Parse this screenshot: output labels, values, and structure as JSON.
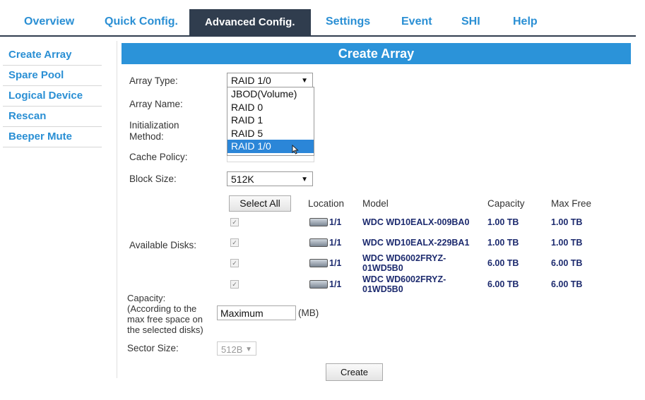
{
  "nav": {
    "tabs": [
      {
        "label": "Overview"
      },
      {
        "label": "Quick Config."
      },
      {
        "label": "Advanced Config."
      },
      {
        "label": "Settings"
      },
      {
        "label": "Event"
      },
      {
        "label": "SHI"
      },
      {
        "label": "Help"
      }
    ],
    "active_tab": "Advanced Config."
  },
  "sidebar": {
    "items": [
      {
        "label": "Create Array"
      },
      {
        "label": "Spare Pool"
      },
      {
        "label": "Logical Device"
      },
      {
        "label": "Rescan"
      },
      {
        "label": "Beeper Mute"
      }
    ]
  },
  "page": {
    "title": "Create Array"
  },
  "form": {
    "array_type": {
      "label": "Array Type:",
      "value": "RAID 1/0",
      "options": [
        "JBOD(Volume)",
        "RAID 0",
        "RAID 1",
        "RAID 5",
        "RAID 1/0"
      ],
      "highlighted": "RAID 1/0"
    },
    "array_name": {
      "label": "Array Name:"
    },
    "init_method": {
      "label_line1": "Initialization",
      "label_line2": "Method:"
    },
    "cache_policy": {
      "label": "Cache Policy:"
    },
    "block_size": {
      "label": "Block Size:",
      "value": "512K"
    },
    "available_disks": {
      "label": "Available Disks:"
    },
    "capacity": {
      "label_lines": [
        "Capacity:",
        "(According to the",
        "max free space on",
        "the selected disks)"
      ],
      "value": "Maximum",
      "unit": "(MB)"
    },
    "sector_size": {
      "label": "Sector Size:",
      "value": "512B"
    },
    "create_button": "Create"
  },
  "disks": {
    "select_all": "Select All",
    "headers": {
      "location": "Location",
      "model": "Model",
      "capacity": "Capacity",
      "max_free": "Max Free"
    },
    "rows": [
      {
        "checked": true,
        "location": "1/1",
        "model_line1": "WDC WD10EALX-009BA0",
        "model_line2": "",
        "capacity": "1.00 TB",
        "max_free": "1.00 TB"
      },
      {
        "checked": true,
        "location": "1/1",
        "model_line1": "WDC WD10EALX-229BA1",
        "model_line2": "",
        "capacity": "1.00 TB",
        "max_free": "1.00 TB"
      },
      {
        "checked": true,
        "location": "1/1",
        "model_line1": "WDC WD6002FRYZ-",
        "model_line2": "01WD5B0",
        "capacity": "6.00 TB",
        "max_free": "6.00 TB"
      },
      {
        "checked": true,
        "location": "1/1",
        "model_line1": "WDC WD6002FRYZ-",
        "model_line2": "01WD5B0",
        "capacity": "6.00 TB",
        "max_free": "6.00 TB"
      }
    ]
  },
  "colors": {
    "nav_active": "#303d4e",
    "accent": "#2b93d9",
    "link": "#2a8fd4",
    "disk_text": "#1c2a6e"
  }
}
